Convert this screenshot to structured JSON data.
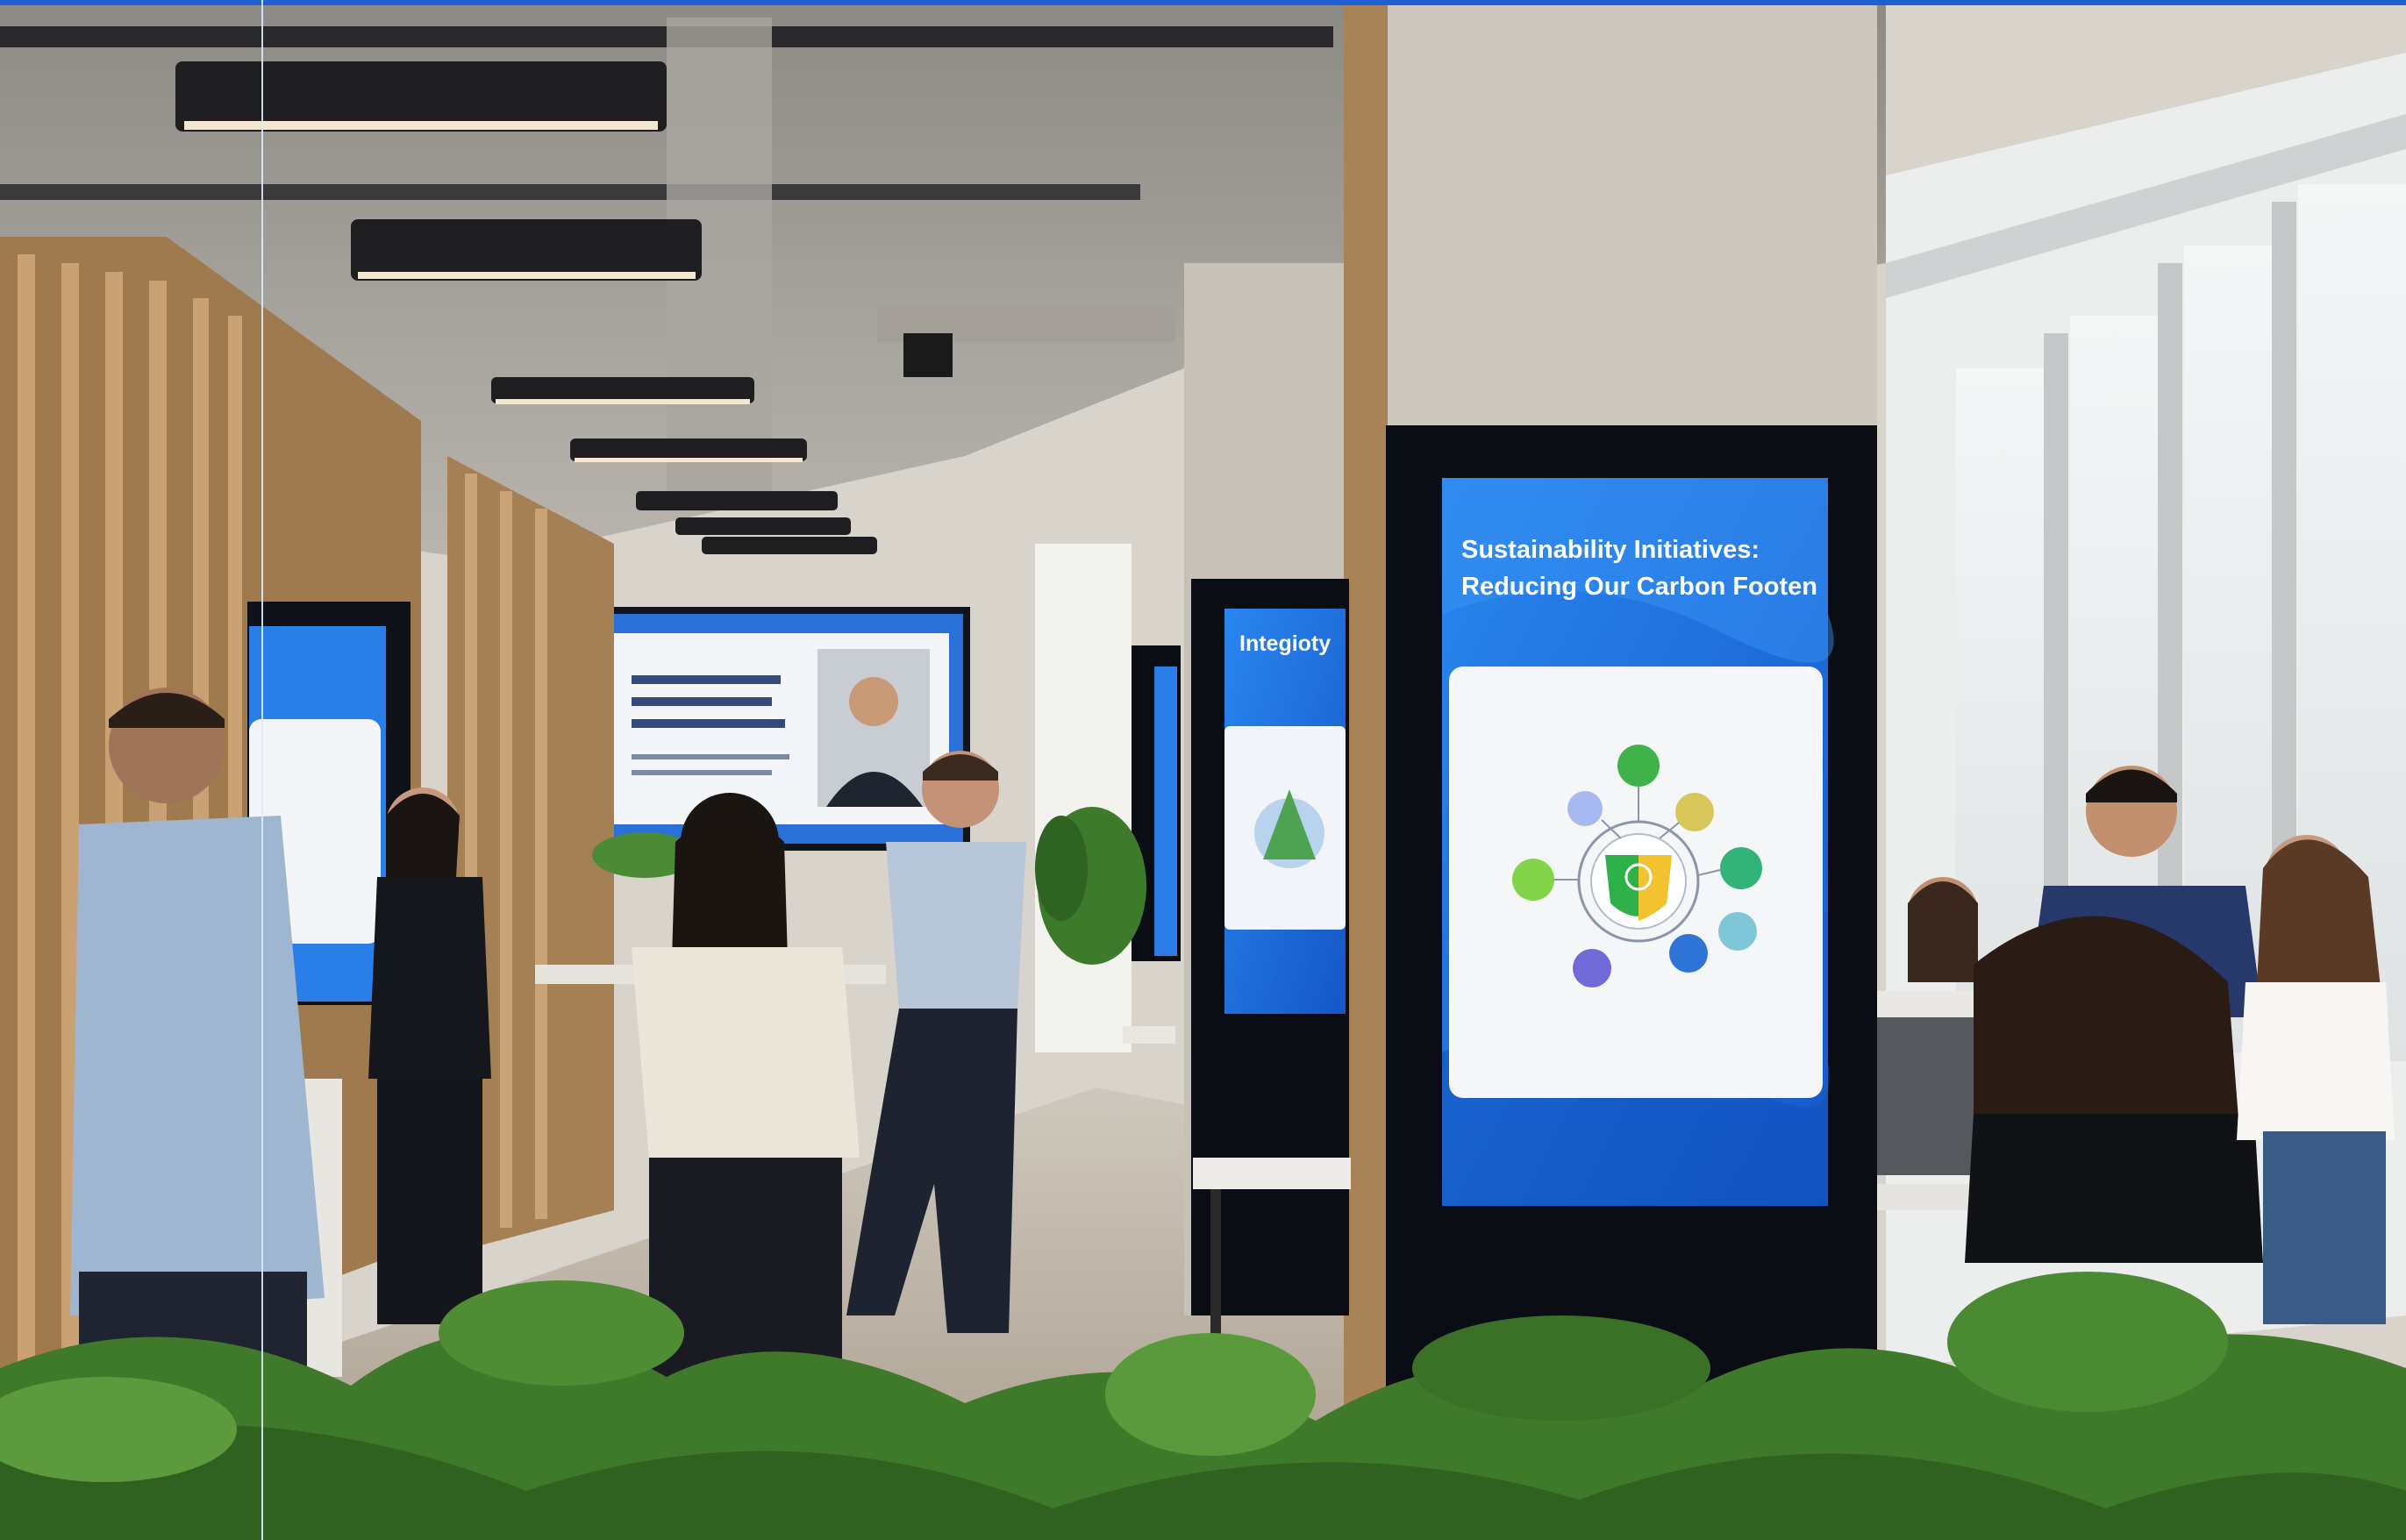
{
  "signage": {
    "main_display": {
      "title_line1": "Sustainability Initiatives:",
      "title_line2": "Reducing Our Carbon Footen"
    },
    "integrity_display": {
      "title": "Integioty"
    }
  },
  "colors": {
    "accent_blue": "#1f6ee0",
    "display_bezel": "#0b0d14",
    "column_concrete": "#cdc7be",
    "wood_slats": "#b08a5e",
    "foliage": "#3f7a2a"
  }
}
